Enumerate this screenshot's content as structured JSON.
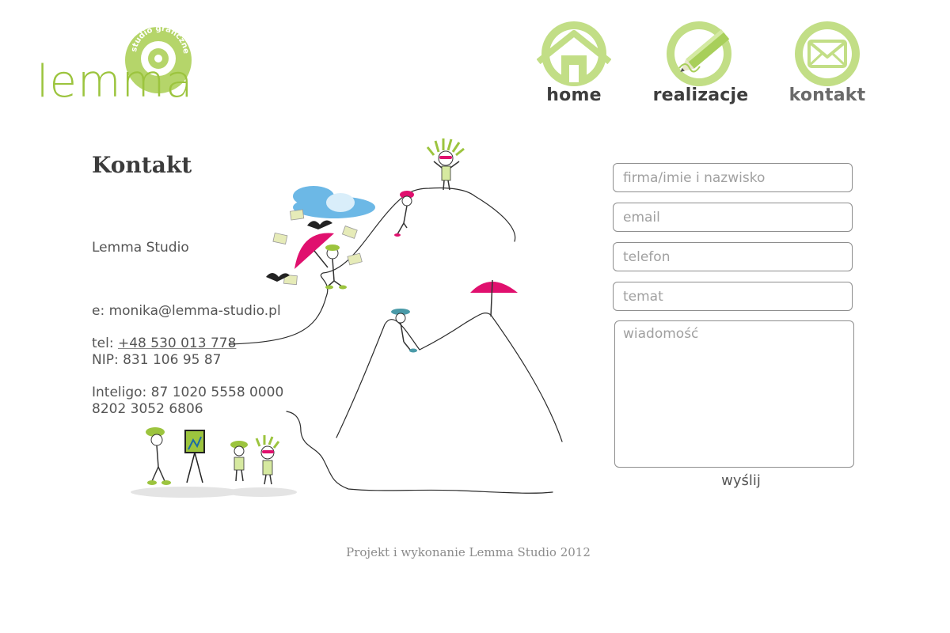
{
  "logo": {
    "wordmark": "lemma",
    "badge_text": "studio graficzne"
  },
  "nav": [
    {
      "label": "home",
      "icon": "house-icon"
    },
    {
      "label": "realizacje",
      "icon": "pencil-icon"
    },
    {
      "label": "kontakt",
      "icon": "envelope-icon"
    }
  ],
  "page": {
    "title": "Kontakt",
    "studio_name": "Lemma Studio",
    "email": "e: monika@lemma-studio.pl",
    "tel_prefix": "tel: ",
    "tel_number": "+48 530 013 778",
    "nip": "NIP: 831 106 95 87",
    "bank_line1": "Inteligo: 87 1020 5558 0000",
    "bank_line2": "8202 3052 6806"
  },
  "form": {
    "name_placeholder": "firma/imie i nazwisko",
    "email_placeholder": "email",
    "phone_placeholder": "telefon",
    "subject_placeholder": "temat",
    "message_placeholder": "wiadomość",
    "send_label": "wyślij"
  },
  "footer": {
    "text": "Projekt i wykonanie Lemma Studio 2012"
  },
  "colors": {
    "accent_green": "#b5d56a",
    "dark_green": "#8cb33a",
    "pink": "#e0106e",
    "text": "#555555"
  }
}
